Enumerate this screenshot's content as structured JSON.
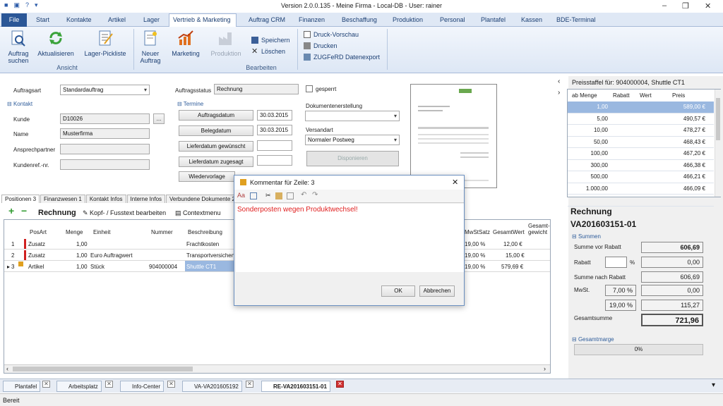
{
  "window": {
    "title": "Version 2.0.0.135 - Meine Firma - Local-DB - User: rainer",
    "qat_icons": [
      "save-icon",
      "print-icon",
      "help-icon",
      "dropdown-icon"
    ],
    "controls": [
      "–",
      "❐",
      "✕"
    ]
  },
  "menu": {
    "file": "File",
    "items": [
      "Start",
      "Kontakte",
      "Artikel",
      "Lager",
      "Vertrieb & Marketing",
      "Auftrag CRM",
      "Finanzen",
      "Beschaffung",
      "Produktion",
      "Personal",
      "Plantafel",
      "Kassen",
      "BDE-Terminal"
    ],
    "active": "Vertrieb & Marketing"
  },
  "ribbon": {
    "auftrag_suchen": "Auftrag suchen",
    "aktualisieren": "Aktualisieren",
    "lager_pickliste": "Lager-Pickliste",
    "neuer_auftrag": "Neuer Auftrag",
    "marketing": "Marketing",
    "produktion": "Produktion",
    "speichern": "Speichern",
    "loeschen": "Löschen",
    "druck_vorschau": "Druck-Vorschau",
    "drucken": "Drucken",
    "zugferd": "ZUGFeRD Datenexport",
    "group_ansicht": "Ansicht",
    "group_bearbeiten": "Bearbeiten"
  },
  "form": {
    "auftragsart_label": "Auftragsart",
    "auftragsart_value": "Standardauftrag",
    "kontakt_group": "Kontakt",
    "kunde_label": "Kunde",
    "kunde_value": "D10026",
    "kunde_btn": "...",
    "name_label": "Name",
    "name_value": "Musterfirma",
    "ansprechpartner_label": "Ansprechpartner",
    "kundenref_label": "Kundenref.-nr.",
    "auftragsstatus_label": "Auftragsstatus",
    "auftragsstatus_value": "Rechnung",
    "termine_group": "Termine",
    "auftragsdatum_btn": "Auftragsdatum",
    "auftragsdatum_value": "30.03.2015",
    "belegdatum_btn": "Belegdatum",
    "belegdatum_value": "30.03.2015",
    "lieferdatum_gew_btn": "Lieferdatum gewünscht",
    "lieferdatum_zug_btn": "Lieferdatum zugesagt",
    "wiedervorlage_btn": "Wiedervorlage",
    "gesperrt_label": "gesperrt",
    "dokumentenerstellung_label": "Dokumentenerstellung",
    "versandart_label": "Versandart",
    "versandart_value": "Normaler Postweg",
    "disponieren_btn": "Disponieren"
  },
  "tabs": [
    "Positionen 3",
    "Finanzwesen 1",
    "Kontakt Infos",
    "Interne Infos",
    "Verbundene Dokumente 2"
  ],
  "toolbar": {
    "rechnung": "Rechnung",
    "kopf_fusstext": "Kopf- / Fusstext bearbeiten",
    "contextmenu": "Contextmenu"
  },
  "grid": {
    "headers": [
      "PosArt",
      "Menge",
      "Einheit",
      "Nummer",
      "Beschreibung",
      "MwStSatz",
      "GesamtWert",
      "Gesamt-gewicht"
    ],
    "rows": [
      {
        "nr": "1",
        "posart": "Zusatz",
        "menge": "1,00",
        "einheit": "",
        "nummer": "",
        "beschreibung": "Frachtkosten",
        "mwst": "19,00 %",
        "gesamt": "12,00 €"
      },
      {
        "nr": "2",
        "posart": "Zusatz",
        "menge": "1,00",
        "einheit": "Euro Auftragwert",
        "nummer": "",
        "beschreibung": "Transportversichen",
        "mwst": "19,00 %",
        "gesamt": "15,00 €"
      },
      {
        "nr": "3",
        "posart": "Artikel",
        "menge": "1,00",
        "einheit": "Stück",
        "nummer": "904000004",
        "beschreibung": "Shuttle CT1",
        "mwst": "19,00 %",
        "gesamt": "579,69 €"
      }
    ]
  },
  "dialog": {
    "title": "Kommentar für Zeile: 3",
    "text": "Sonderposten wegen Produktwechsel!",
    "ok": "OK",
    "abbrechen": "Abbrechen"
  },
  "preisstaffel": {
    "title": "Preisstaffel für: 904000004, Shuttle CT1",
    "headers": [
      "ab Menge",
      "Rabatt",
      "Wert",
      "Preis"
    ],
    "rows": [
      {
        "menge": "1,00",
        "preis": "589,00 €"
      },
      {
        "menge": "5,00",
        "preis": "490,57 €"
      },
      {
        "menge": "10,00",
        "preis": "478,27 €"
      },
      {
        "menge": "50,00",
        "preis": "468,43 €"
      },
      {
        "menge": "100,00",
        "preis": "467,20 €"
      },
      {
        "menge": "300,00",
        "preis": "466,38 €"
      },
      {
        "menge": "500,00",
        "preis": "466,21 €"
      },
      {
        "menge": "1.000,00",
        "preis": "466,09 €"
      },
      {
        "menge": "",
        "preis": ""
      }
    ]
  },
  "summary": {
    "doc_type": "Rechnung",
    "doc_number": "VA201603151-01",
    "summen_group": "Summen",
    "summe_vor_rabatt_label": "Summe vor Rabatt",
    "summe_vor_rabatt": "606,69",
    "rabatt_label": "Rabatt",
    "rabatt_pct_sign": "%",
    "rabatt_value": "0,00",
    "summe_nach_rabatt_label": "Summe nach Rabatt",
    "summe_nach_rabatt": "606,69",
    "mwst_label": "MwSt.",
    "mwst_rate1": "7,00 %",
    "mwst_val1": "0,00",
    "mwst_rate2": "19,00 %",
    "mwst_val2": "115,27",
    "gesamtsumme_label": "Gesamtsumme",
    "gesamtsumme": "721,96",
    "gesamtmarge_group": "Gesamtmarge",
    "gesamtmarge": "0%"
  },
  "bottom_tabs": [
    "Plantafel",
    "Arbeitsplatz",
    "Info-Center",
    "VA-VA201605192",
    "RE-VA201603151-01"
  ],
  "status": "Bereit",
  "colors": {
    "accent": "#2b5797",
    "error_text": "#e02020",
    "ribbon_bg": "#dde7f5"
  }
}
